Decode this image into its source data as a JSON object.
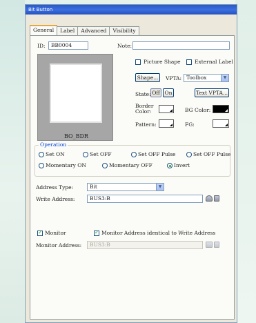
{
  "window": {
    "title": "Bit Button"
  },
  "tabs": [
    "General",
    "Label",
    "Advanced",
    "Visibility"
  ],
  "general": {
    "id_label": "ID:",
    "id_value": "BB0004",
    "note_label": "Note:",
    "note_value": "",
    "preview_caption": "BO_BDR",
    "picture_shape_label": "Picture Shape",
    "picture_shape_checked": false,
    "external_label_label": "External Label",
    "external_label_checked": false,
    "shape_button": "Shape...",
    "vpta_label": "VPTA:",
    "vpta_value": "Toolbox",
    "state_label": "State:",
    "state_off": "Off",
    "state_on": "On",
    "text_vpta_button": "Text VPTA...",
    "border_color_label": "Border Color:",
    "bg_color_label": "BG Color:",
    "pattern_label": "Pattern:",
    "fg_label": "FG:",
    "colors": {
      "border": "#ffffff",
      "bg": "#000000",
      "pattern": "#ffffff",
      "fg": "#ffffff"
    }
  },
  "operation": {
    "title": "Operation",
    "options": [
      "Set ON",
      "Set OFF",
      "Set OFF Pulse",
      "Set OFF Pulse",
      "Momentary ON",
      "Momentary OFF",
      "Invert"
    ],
    "selected": "Invert"
  },
  "address": {
    "type_label": "Address Type:",
    "type_value": "Bit",
    "write_label": "Write Address:",
    "write_value": "BUS3:B"
  },
  "monitor": {
    "monitor_label": "Monitor",
    "monitor_checked": true,
    "identical_label": "Monitor Address identical to Write Address",
    "identical_checked": true,
    "address_label": "Monitor Address:",
    "address_value": "BUS3:B"
  }
}
